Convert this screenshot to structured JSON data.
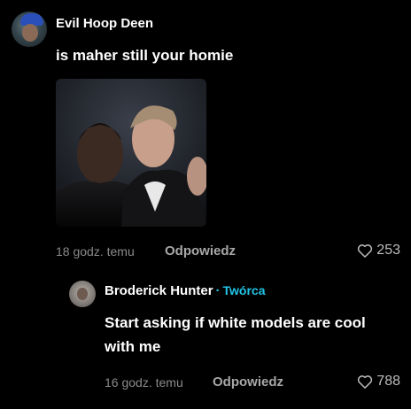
{
  "comment": {
    "author": "Evil Hoop Deen",
    "text": "is maher still your homie",
    "time": "18 godz. temu",
    "reply_label": "Odpowiedz",
    "likes": "253"
  },
  "reply": {
    "author": "Broderick Hunter",
    "separator": "·",
    "badge": "Twórca",
    "text": "Start asking if white models are cool with me",
    "time": "16 godz. temu",
    "reply_label": "Odpowiedz",
    "likes": "788"
  },
  "colors": {
    "background": "#000000",
    "creator_badge": "#20c5e6",
    "muted": "#8a8a8a"
  },
  "icons": {
    "like": "heart-outline-icon"
  }
}
